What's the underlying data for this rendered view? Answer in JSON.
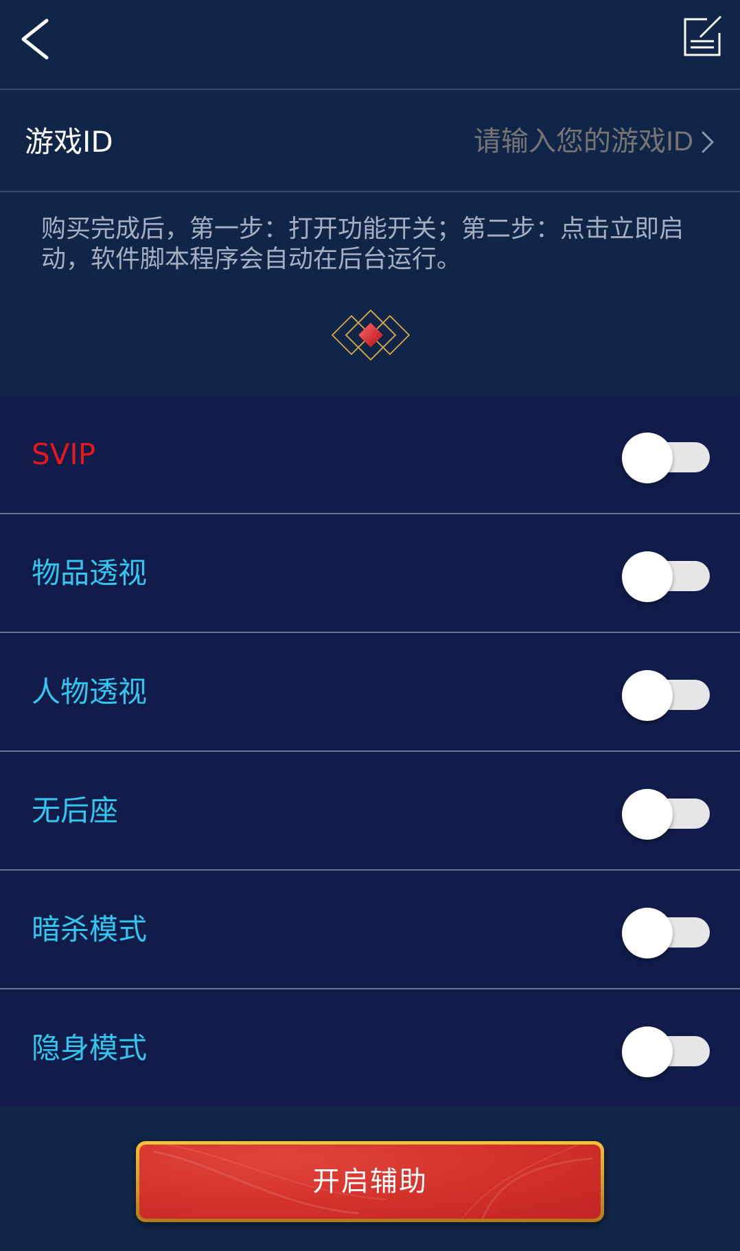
{
  "header": {
    "back_icon": "chevron-left-icon",
    "edit_icon": "edit-note-icon"
  },
  "game_id": {
    "label": "游戏ID",
    "placeholder": "请输入您的游戏ID",
    "chevron_icon": "chevron-right-icon"
  },
  "notice": {
    "text": "购买完成后，第一步：打开功能开关；第二步：点击立即启动，软件脚本程序会自动在后台运行。"
  },
  "toggles": [
    {
      "label": "SVIP",
      "on": false,
      "color": "#e3191e"
    },
    {
      "label": "物品透视",
      "on": false,
      "color": "#33c7ef"
    },
    {
      "label": "人物透视",
      "on": false,
      "color": "#33c7ef"
    },
    {
      "label": "无后座",
      "on": false,
      "color": "#33c7ef"
    },
    {
      "label": "暗杀模式",
      "on": false,
      "color": "#33c7ef"
    },
    {
      "label": "隐身模式",
      "on": false,
      "color": "#33c7ef"
    }
  ],
  "start_button": {
    "label": "开启辅助"
  },
  "colors": {
    "background": "#112548",
    "list_background": "#111c4a",
    "accent_gold": "#c9a24a",
    "button_red": "#d3302a"
  }
}
